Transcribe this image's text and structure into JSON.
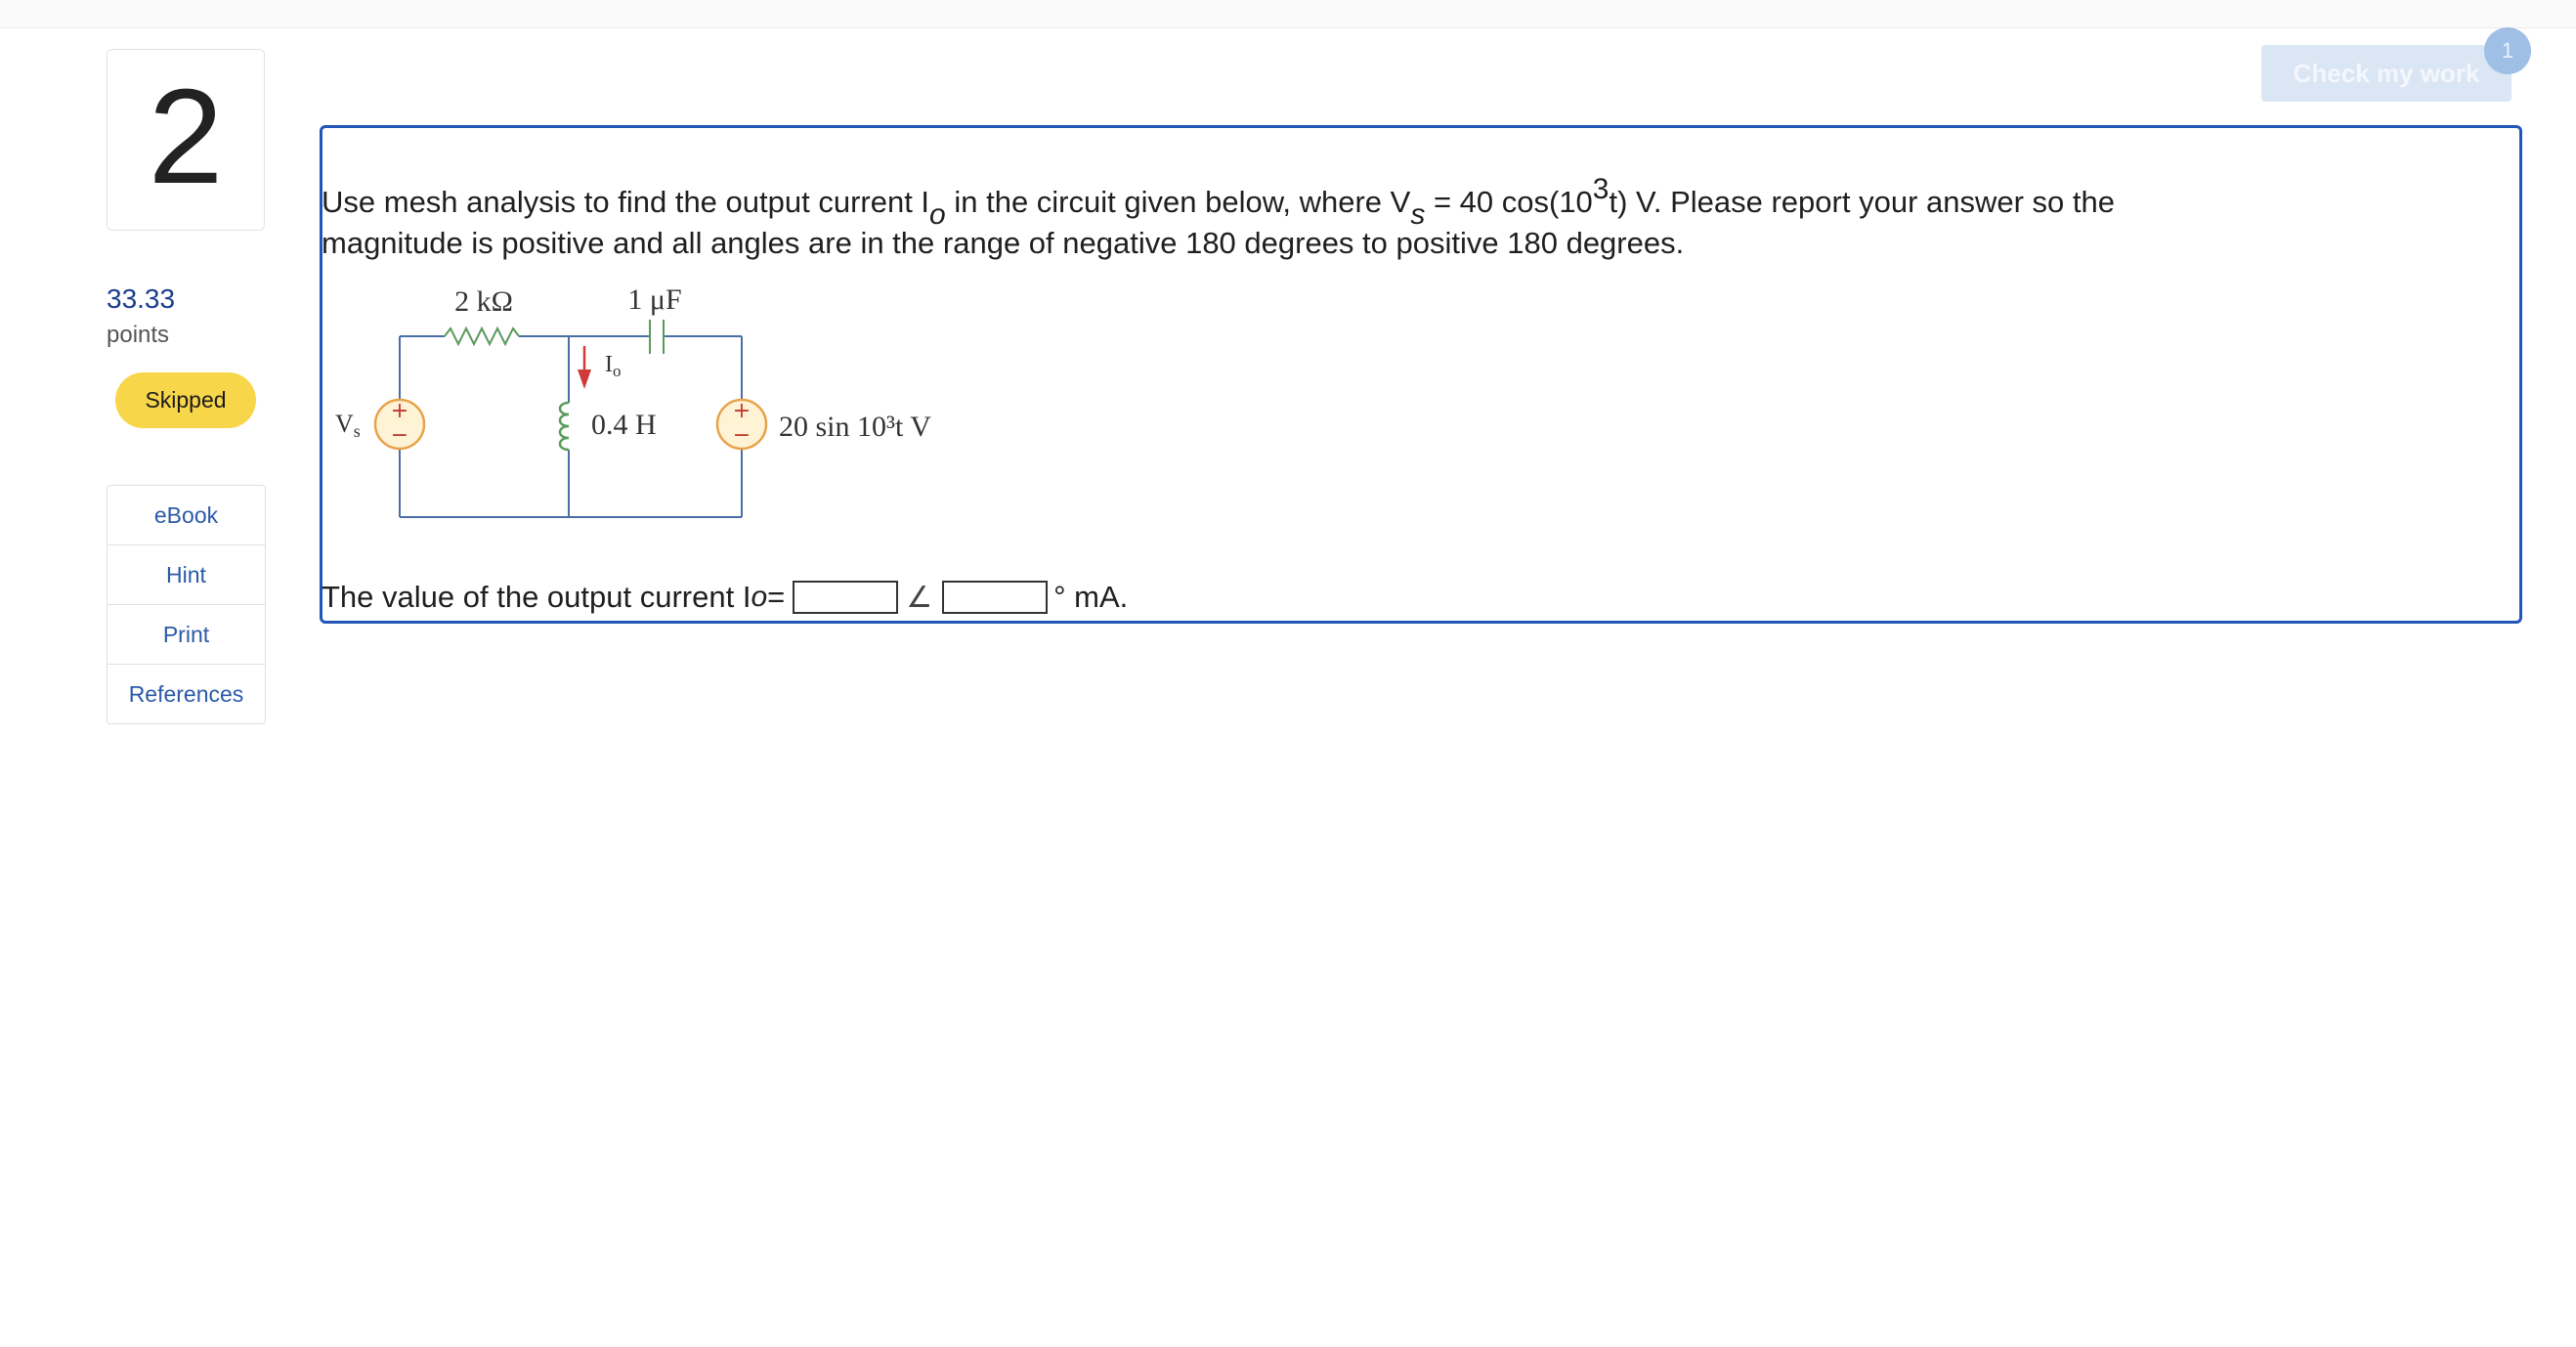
{
  "question": {
    "number": "2",
    "points_value": "33.33",
    "points_label": "points",
    "status": "Skipped",
    "text_line1_a": "Use mesh analysis to find the output current I",
    "text_line1_b": " in the circuit given below, where V",
    "text_line1_c": " = 40 cos(10",
    "text_line1_d": "t) V. Please report your answer so the",
    "text_sub_o": "o",
    "text_sub_s": "s",
    "text_sup_3": "3",
    "text_line2": "magnitude is positive and all angles are in the range of negative 180 degrees to positive 180 degrees."
  },
  "tools": [
    "eBook",
    "Hint",
    "Print",
    "References"
  ],
  "check_button": {
    "label": "Check my work",
    "badge": "1"
  },
  "circuit": {
    "resistor_label": "2 kΩ",
    "capacitor_label": "1 μF",
    "current_label": "I",
    "current_sub": "o",
    "inductor_label": "0.4 H",
    "source_left_label": "V",
    "source_left_sub": "s",
    "source_right_label": "20 sin 10³t  V",
    "plus": "+",
    "minus": "−"
  },
  "answer": {
    "prefix": "The value of the output current I",
    "sub": "o",
    "equals": " =",
    "angle_symbol": "∠",
    "suffix": "° mA.",
    "magnitude_value": "",
    "angle_value": ""
  },
  "colors": {
    "accent_blue": "#2156b8",
    "status_yellow": "#f8d64a",
    "wire": "#4a6fa5",
    "component_green": "#5a9a5a",
    "source_orange": "#e8a24a",
    "arrow_red": "#d23a3a"
  }
}
